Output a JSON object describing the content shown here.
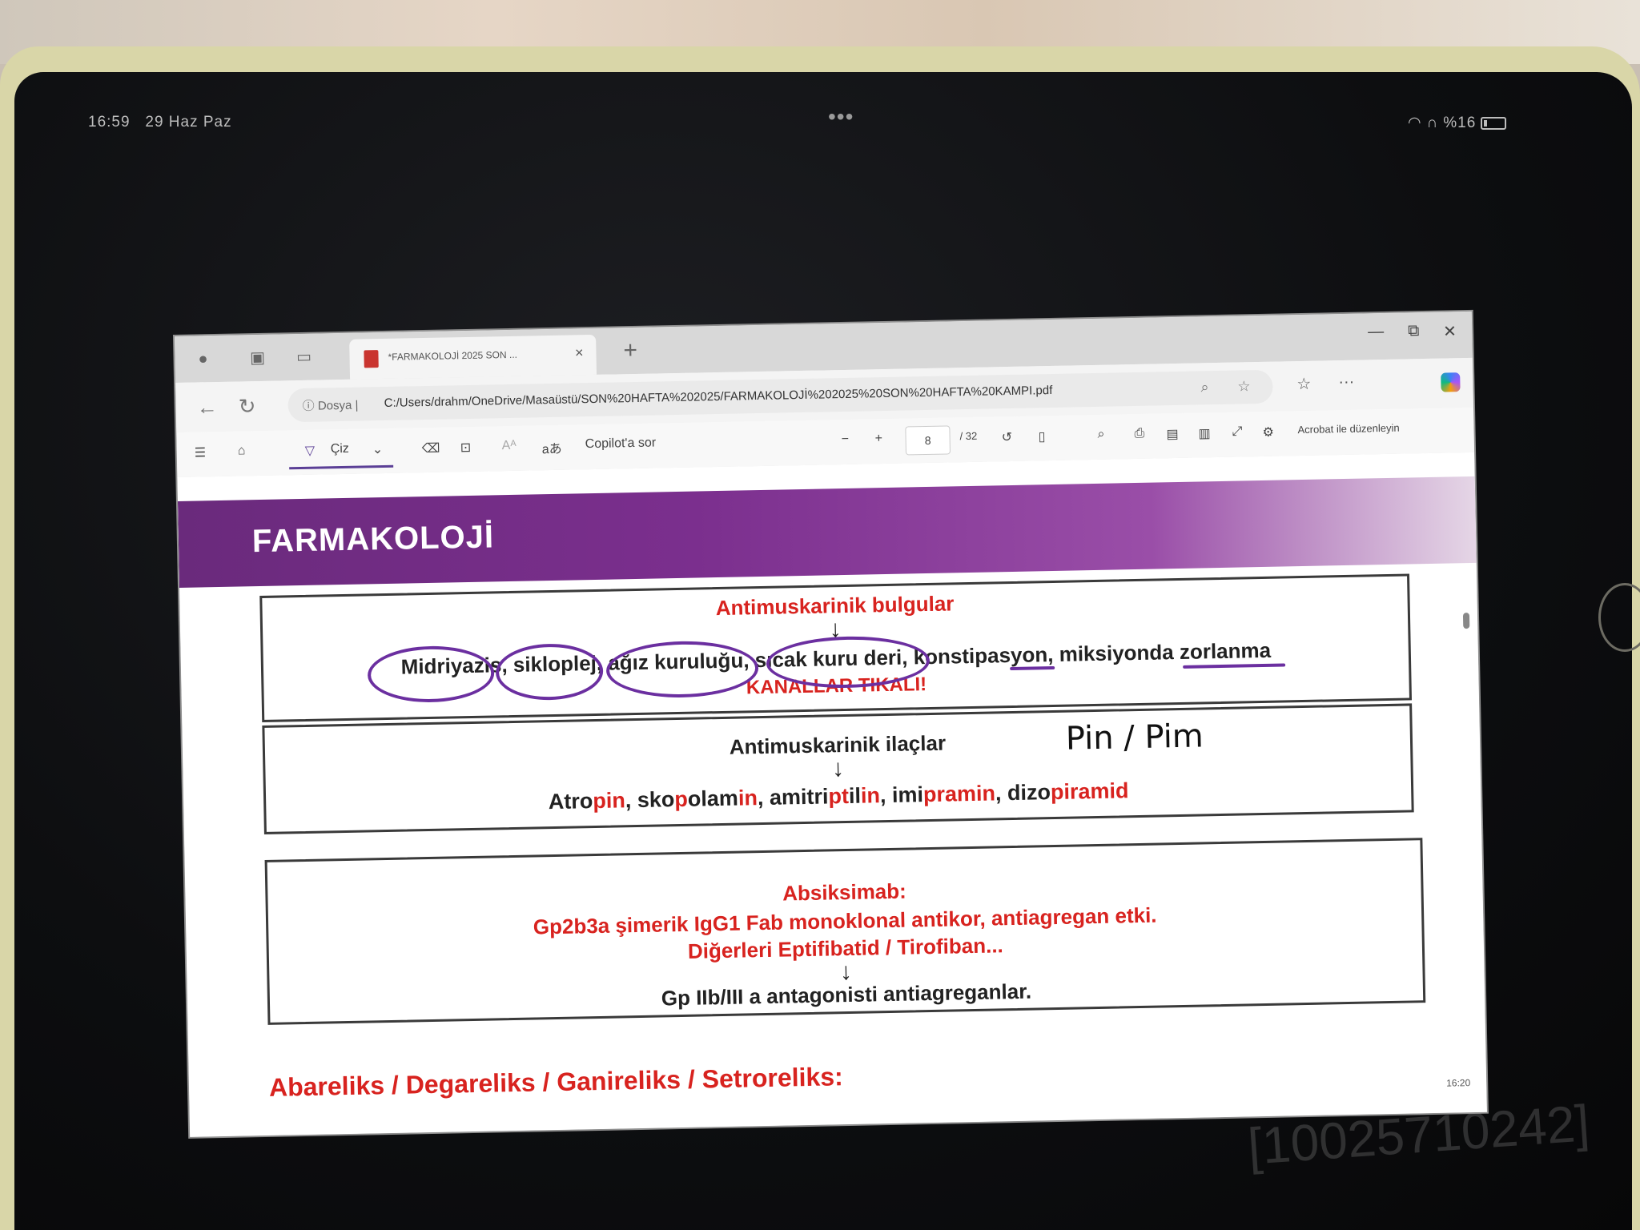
{
  "status_bar": {
    "time": "16:59",
    "date": "29 Haz Paz",
    "multitask_dots": "•••",
    "battery_percent": "%16"
  },
  "browser": {
    "tab_title": "*FARMAKOLOJİ 2025 SON ...",
    "tab_close": "×",
    "new_tab": "+",
    "window_controls": {
      "minimize": "—",
      "restore": "⧉",
      "close": "✕"
    },
    "address": {
      "scheme_label": "Dosya",
      "url": "C:/Users/drahm/OneDrive/Masaüstü/SON%20HAFTA%202025/FARMAKOLOJİ%202025%20SON%20HAFTA%20KAMPI.pdf"
    },
    "toolbar": {
      "draw_label": "Çiz",
      "read_aloud": "aあ",
      "copilot_label": "Copilot'a sor",
      "zoom_out": "−",
      "zoom_in": "+",
      "page_current": "8",
      "page_total": "/ 32",
      "acrobat_label": "Acrobat ile düzenleyin"
    }
  },
  "document": {
    "header_title": "FARMAKOLOJİ",
    "box1": {
      "heading": "Antimuskarinik bulgular",
      "arrow": "↓",
      "findings": "Midriyazis, sikloplej, ağız kuruluğu, sıcak kuru deri, konstipasyon, miksiyonda zorlanma",
      "note": "KANALLAR TIKALI!"
    },
    "box2": {
      "heading": "Antimuskarinik ilaçlar",
      "handwritten": "Pin / Pim",
      "arrow": "↓",
      "drugs": [
        {
          "base": "Atro",
          "hl": "pin"
        },
        {
          "base": "sko",
          "hl": "p",
          "rest": "olam",
          "hl2": "in"
        },
        {
          "base": "amitri",
          "hl": "pt",
          "rest": "il",
          "hl2": "in"
        },
        {
          "base": "imi",
          "hl": "pram",
          "rest": "",
          "hl2": "in"
        },
        {
          "base": "dizo",
          "hl": "pira",
          "rest": "",
          "hl2": "mid"
        }
      ]
    },
    "box3": {
      "line1": "Absiksimab:",
      "line2": "Gp2b3a şimerik IgG1 Fab monoklonal antikor, antiagregan etki.",
      "line3": "Diğerleri Eptifibatid / Tirofiban...",
      "arrow": "↓",
      "line4": "Gp IIb/III a  antagonisti antiagreganlar."
    },
    "bottom_line": "Abareliks / Degareliks / Ganireliks / Setroreliks:",
    "tray_time": "16:20"
  },
  "watermark": "[10025710242]",
  "colors": {
    "accent_purple": "#7b2f8e",
    "highlight_red": "#d8231f",
    "ink_purple": "#6b2fa0"
  }
}
